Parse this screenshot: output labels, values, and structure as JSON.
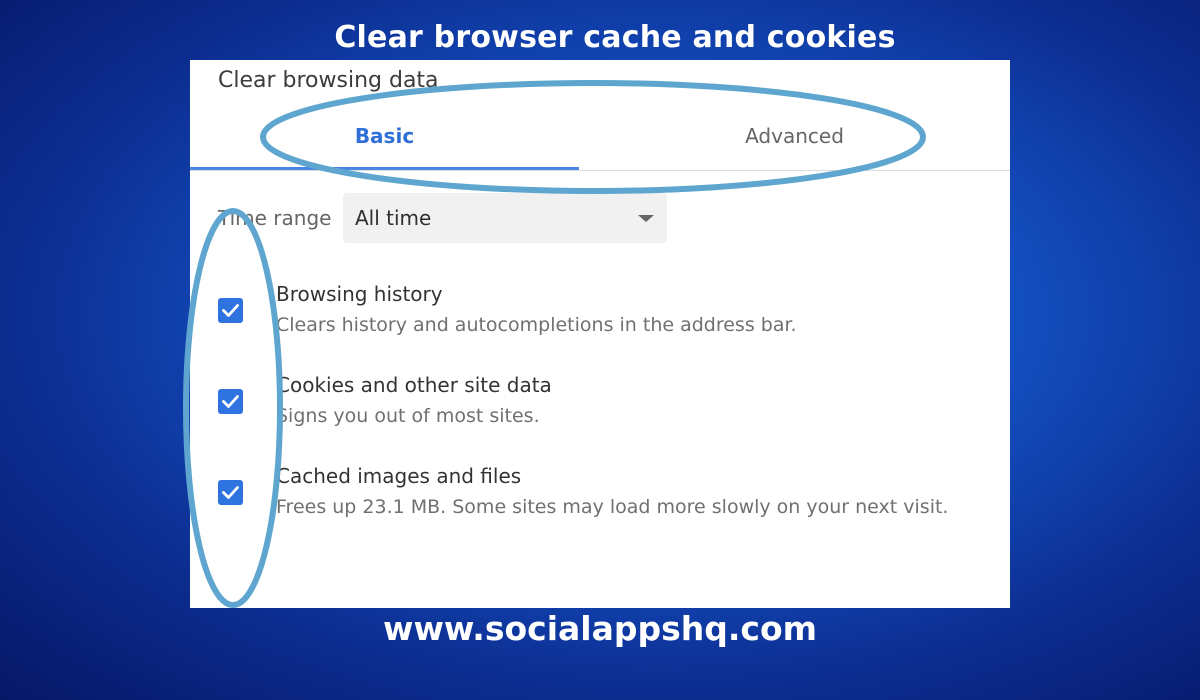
{
  "headline": "Clear browser cache and cookies",
  "footer_url": "www.socialappshq.com",
  "dialog": {
    "title": "Clear browsing data",
    "tabs": [
      {
        "label": "Basic",
        "active": true
      },
      {
        "label": "Advanced",
        "active": false
      }
    ],
    "time_range": {
      "label": "Time range",
      "value": "All time"
    },
    "options": [
      {
        "title": "Browsing history",
        "description": "Clears history and autocompletions in the address bar.",
        "checked": true
      },
      {
        "title": "Cookies and other site data",
        "description": "Signs you out of most sites.",
        "checked": true
      },
      {
        "title": "Cached images and files",
        "description": "Frees up 23.1 MB. Some sites may load more slowly on your next visit.",
        "checked": true
      }
    ]
  },
  "colors": {
    "accent_blue": "#2e73e0",
    "annotation_ring": "#5ea6cf",
    "background_dark": "#061766",
    "background_light": "#1d74e6"
  },
  "icons": {
    "checkbox": "checkmark-icon",
    "select": "dropdown-caret-icon"
  }
}
